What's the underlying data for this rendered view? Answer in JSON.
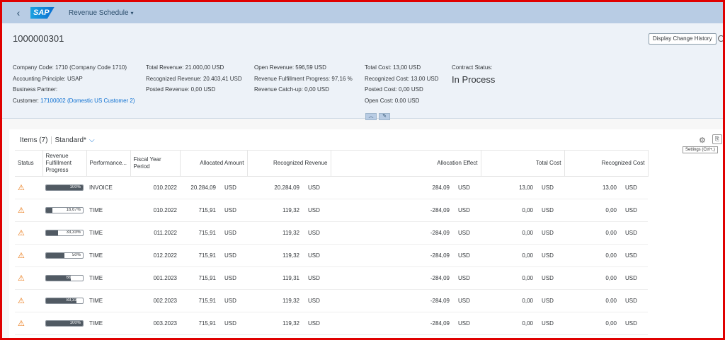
{
  "shell": {
    "back_icon": "chevron-left-icon",
    "logo": "SAP",
    "app_title": "Revenue Schedule",
    "caret": "▾"
  },
  "header": {
    "object_id": "1000000301",
    "history_button": "Display Change History"
  },
  "facets": {
    "col1": [
      {
        "label": "Company Code:",
        "value": "1710 (Company Code 1710)"
      },
      {
        "label": "Accounting Principle:",
        "value": "USAP"
      },
      {
        "label": "Business Partner:",
        "value": ""
      },
      {
        "label": "Customer:",
        "value": "17100002 (Domestic US Customer 2)"
      }
    ],
    "col2": [
      {
        "label": "Total Revenue:",
        "value": "21.000,00  USD"
      },
      {
        "label": "Recognized Revenue:",
        "value": "20.403,41  USD"
      },
      {
        "label": "Posted Revenue:",
        "value": "0,00  USD"
      }
    ],
    "col3": [
      {
        "label": "Open Revenue:",
        "value": "596,59  USD"
      },
      {
        "label": "Revenue Fulfillment Progress:",
        "value": "97,16 %"
      },
      {
        "label": "Revenue Catch-up:",
        "value": "0,00  USD"
      }
    ],
    "col4": [
      {
        "label": "Total Cost:",
        "value": "13,00  USD"
      },
      {
        "label": "Recognized Cost:",
        "value": "13,00  USD"
      },
      {
        "label": "Posted Cost:",
        "value": "0,00  USD"
      },
      {
        "label": "Open Cost:",
        "value": "0,00  USD"
      }
    ],
    "status_label": "Contract Status:",
    "status_value": "In Process",
    "collapse_icon": "chevron-up-icon",
    "pin_icon": "pin-icon"
  },
  "table": {
    "title": "Items (7)",
    "variant": "Standard*",
    "settings_tooltip": "Settings (Ctrl+,)",
    "columns": [
      "Status",
      "Revenue Fulfillment Progress",
      "Performance...",
      "Fiscal Year Period",
      "Allocated Amount",
      "Recognized Revenue",
      "Allocation Effect",
      "Total Cost",
      "Recognized Cost"
    ],
    "rows": [
      {
        "progress": 100,
        "progress_text": "100%",
        "perf": "INVOICE",
        "period": "010.2022",
        "alloc": "20.284,09",
        "alloc_cur": "USD",
        "recog": "20.284,09",
        "recog_cur": "USD",
        "effect": "284,09",
        "effect_cur": "USD",
        "cost": "13,00",
        "cost_cur": "USD",
        "rcost": "13,00",
        "rcost_cur": "USD"
      },
      {
        "progress": 16.67,
        "progress_text": "16,67%",
        "perf": "TIME",
        "period": "010.2022",
        "alloc": "715,91",
        "alloc_cur": "USD",
        "recog": "119,32",
        "recog_cur": "USD",
        "effect": "-284,09",
        "effect_cur": "USD",
        "cost": "0,00",
        "cost_cur": "USD",
        "rcost": "0,00",
        "rcost_cur": "USD"
      },
      {
        "progress": 33.33,
        "progress_text": "33,33%",
        "perf": "TIME",
        "period": "011.2022",
        "alloc": "715,91",
        "alloc_cur": "USD",
        "recog": "119,32",
        "recog_cur": "USD",
        "effect": "-284,09",
        "effect_cur": "USD",
        "cost": "0,00",
        "cost_cur": "USD",
        "rcost": "0,00",
        "rcost_cur": "USD"
      },
      {
        "progress": 50,
        "progress_text": "50%",
        "perf": "TIME",
        "period": "012.2022",
        "alloc": "715,91",
        "alloc_cur": "USD",
        "recog": "119,32",
        "recog_cur": "USD",
        "effect": "-284,09",
        "effect_cur": "USD",
        "cost": "0,00",
        "cost_cur": "USD",
        "rcost": "0,00",
        "rcost_cur": "USD"
      },
      {
        "progress": 66.67,
        "progress_text": "66,67%",
        "perf": "TIME",
        "period": "001.2023",
        "alloc": "715,91",
        "alloc_cur": "USD",
        "recog": "119,31",
        "recog_cur": "USD",
        "effect": "-284,09",
        "effect_cur": "USD",
        "cost": "0,00",
        "cost_cur": "USD",
        "rcost": "0,00",
        "rcost_cur": "USD"
      },
      {
        "progress": 83.33,
        "progress_text": "83,33%",
        "perf": "TIME",
        "period": "002.2023",
        "alloc": "715,91",
        "alloc_cur": "USD",
        "recog": "119,32",
        "recog_cur": "USD",
        "effect": "-284,09",
        "effect_cur": "USD",
        "cost": "0,00",
        "cost_cur": "USD",
        "rcost": "0,00",
        "rcost_cur": "USD"
      },
      {
        "progress": 100,
        "progress_text": "100%",
        "perf": "TIME",
        "period": "003.2023",
        "alloc": "715,91",
        "alloc_cur": "USD",
        "recog": "119,32",
        "recog_cur": "USD",
        "effect": "-284,09",
        "effect_cur": "USD",
        "cost": "0,00",
        "cost_cur": "USD",
        "rcost": "0,00",
        "rcost_cur": "USD"
      }
    ]
  },
  "colors": {
    "frame": "#e00000",
    "shell": "#b8cce4",
    "accent": "#0a6ed1",
    "warning": "#e9730c",
    "progress": "#515a63"
  }
}
